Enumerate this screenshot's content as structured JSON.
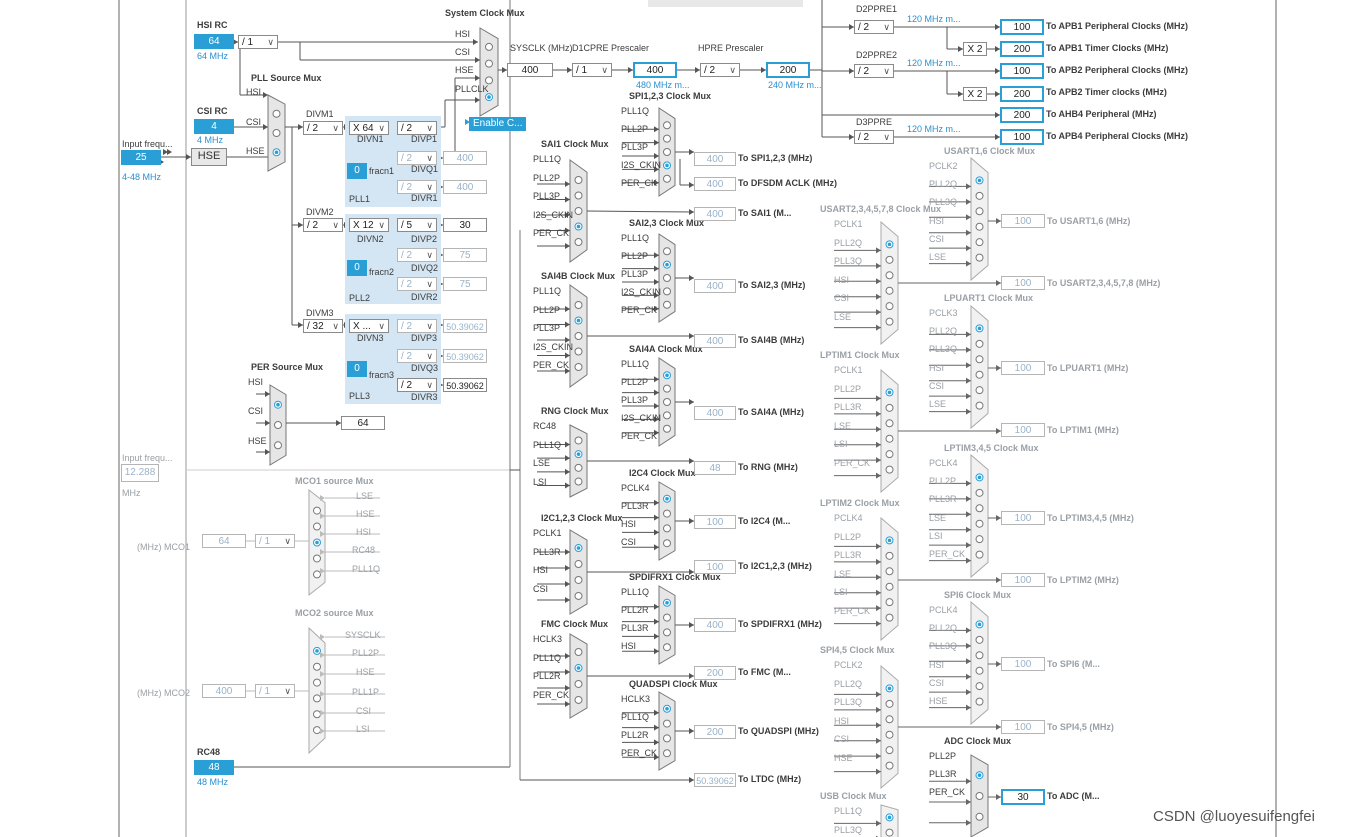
{
  "watermark": "CSDN @luoyesuifengfei",
  "sources": {
    "hsi_rc": {
      "title": "HSI RC",
      "value": "64",
      "freq": "64 MHz"
    },
    "csi_rc": {
      "title": "CSI RC",
      "value": "4",
      "freq": "4 MHz"
    },
    "input_freq": {
      "title": "Input frequ...",
      "value": "25",
      "range": "4-48 MHz",
      "hse_label": "HSE"
    },
    "input_freq2": {
      "title": "Input frequ...",
      "value": "12.288",
      "unit": "MHz"
    },
    "rc48": {
      "title": "RC48",
      "value": "48",
      "freq": "48 MHz"
    }
  },
  "hsi_div": "/ 1",
  "pll_source_mux": {
    "title": "PLL Source Mux",
    "inputs": [
      "HSI",
      "CSI",
      "HSE"
    ]
  },
  "system_clock_mux": {
    "title": "System Clock Mux",
    "inputs": [
      "HSI",
      "CSI",
      "HSE",
      "PLLCLK"
    ],
    "enable_css": "Enable C..."
  },
  "sysclk": {
    "label": "SYSCLK (MHz)",
    "value": "400"
  },
  "d1cpre": {
    "label": "D1CPRE Prescaler",
    "select": "/ 1",
    "value": "400",
    "sub": "480 MHz m..."
  },
  "hpre": {
    "label": "HPRE Prescaler",
    "select": "/ 2",
    "value": "200",
    "sub": "240 MHz m..."
  },
  "bus_outputs": [
    {
      "pre_label": "D2PPRE1",
      "select": "/ 2",
      "max": "120 MHz m...",
      "value": "100",
      "out": "To APB1 Peripheral Clocks (MHz)"
    },
    {
      "mult": "X 2",
      "value": "200",
      "out": "To APB1 Timer Clocks (MHz)"
    },
    {
      "pre_label": "D2PPRE2",
      "select": "/ 2",
      "max": "120 MHz m...",
      "value": "100",
      "out": "To APB2 Peripheral Clocks (MHz)"
    },
    {
      "mult": "X 2",
      "value": "200",
      "out": "To APB2 Timer clocks (MHz)"
    },
    {
      "value": "200",
      "out": "To AHB4 Peripheral (MHz)"
    },
    {
      "pre_label": "D3PPRE",
      "select": "/ 2",
      "max": "120 MHz m...",
      "value": "100",
      "out": "To APB4 Peripheral Clocks (MHz)"
    }
  ],
  "plls": [
    {
      "divm_label": "DIVM1",
      "divm": "/ 2",
      "divn_label": "DIVN1",
      "divn": "X 64",
      "frac": "0",
      "frac_label": "fracn1",
      "name": "PLL1",
      "outs": [
        {
          "label": "DIVP1",
          "sel": "/ 2",
          "value": ""
        },
        {
          "label": "DIVQ1",
          "sel": "/ 2",
          "value": "400"
        },
        {
          "label": "DIVR1",
          "sel": "/ 2",
          "value": "400"
        }
      ]
    },
    {
      "divm_label": "DIVM2",
      "divm": "/ 2",
      "divn_label": "DIVN2",
      "divn": "X 12",
      "frac": "0",
      "frac_label": "fracn2",
      "name": "PLL2",
      "outs": [
        {
          "label": "DIVP2",
          "sel": "/ 5",
          "value": "30"
        },
        {
          "label": "DIVQ2",
          "sel": "/ 2",
          "value": "75"
        },
        {
          "label": "DIVR2",
          "sel": "/ 2",
          "value": "75"
        }
      ]
    },
    {
      "divm_label": "DIVM3",
      "divm": "/ 32",
      "divn_label": "DIVN3",
      "divn": "X ...",
      "frac": "0",
      "frac_label": "fracn3",
      "name": "PLL3",
      "outs": [
        {
          "label": "DIVP3",
          "sel": "/ 2",
          "value": "50.39062"
        },
        {
          "label": "DIVQ3",
          "sel": "/ 2",
          "value": "50.39062"
        },
        {
          "label": "DIVR3",
          "sel": "/ 2",
          "value": "50.39062"
        }
      ]
    }
  ],
  "per_mux": {
    "title": "PER Source Mux",
    "inputs": [
      "HSI",
      "CSI",
      "HSE"
    ],
    "value": "64"
  },
  "mco1": {
    "title": "MCO1 source Mux",
    "inputs": [
      "LSE",
      "HSE",
      "HSI",
      "RC48",
      "PLL1Q"
    ],
    "label": "(MHz) MCO1",
    "value": "64",
    "div": "/ 1"
  },
  "mco2": {
    "title": "MCO2 source Mux",
    "inputs": [
      "SYSCLK",
      "PLL2P",
      "HSE",
      "PLL1P",
      "CSI",
      "LSI"
    ],
    "label": "(MHz) MCO2",
    "value": "400",
    "div": "/ 1"
  },
  "mid_muxes": [
    {
      "title": "SAI1 Clock Mux",
      "inputs": [
        "PLL1Q",
        "PLL2P",
        "PLL3P",
        "I2S_CKIN",
        "PER_CK"
      ]
    },
    {
      "title": "SAI4B Clock Mux",
      "inputs": [
        "PLL1Q",
        "PLL2P",
        "PLL3P",
        "I2S_CKIN",
        "PER_CK"
      ]
    },
    {
      "title": "RNG Clock Mux",
      "inputs": [
        "RC48",
        "PLL1Q",
        "LSE",
        "LSI"
      ]
    },
    {
      "title": "I2C1,2,3 Clock Mux",
      "inputs": [
        "PCLK1",
        "PLL3R",
        "HSI",
        "CSI"
      ]
    },
    {
      "title": "FMC Clock Mux",
      "inputs": [
        "HCLK3",
        "PLL1Q",
        "PLL2R",
        "PER_CK"
      ]
    }
  ],
  "col2_muxes": [
    {
      "title": "SPI1,2,3 Clock Mux",
      "inputs": [
        "PLL1Q",
        "PLL2P",
        "PLL3P",
        "I2S_CKIN",
        "PER_CK"
      ]
    },
    {
      "title": "SAI2,3 Clock Mux",
      "inputs": [
        "PLL1Q",
        "PLL2P",
        "PLL3P",
        "I2S_CKIN",
        "PER_CK"
      ]
    },
    {
      "title": "SAI4A Clock Mux",
      "inputs": [
        "PLL1Q",
        "PLL2P",
        "PLL3P",
        "I2S_CKIN",
        "PER_CK"
      ]
    },
    {
      "title": "I2C4 Clock Mux",
      "inputs": [
        "PCLK4",
        "PLL3R",
        "HSI",
        "CSI"
      ]
    },
    {
      "title": "SPDIFRX1 Clock Mux",
      "inputs": [
        "PLL1Q",
        "PLL2R",
        "PLL3R",
        "HSI"
      ]
    },
    {
      "title": "QUADSPI Clock Mux",
      "inputs": [
        "HCLK3",
        "PLL1Q",
        "PLL2R",
        "PER_CK"
      ]
    }
  ],
  "col2_outputs": [
    {
      "value": "400",
      "out": "To SPI1,2,3 (MHz)"
    },
    {
      "value": "400",
      "out": "To DFSDM ACLK (MHz)"
    },
    {
      "value": "400",
      "out": "To SAI1 (M..."
    },
    {
      "value": "400",
      "out": "To SAI2,3 (MHz)"
    },
    {
      "value": "400",
      "out": "To SAI4B (MHz)"
    },
    {
      "value": "400",
      "out": "To SAI4A (MHz)"
    },
    {
      "value": "48",
      "out": "To RNG (MHz)"
    },
    {
      "value": "100",
      "out": "To I2C4 (M..."
    },
    {
      "value": "100",
      "out": "To I2C1,2,3 (MHz)"
    },
    {
      "value": "400",
      "out": "To SPDIFRX1 (MHz)"
    },
    {
      "value": "200",
      "out": "To FMC (M..."
    },
    {
      "value": "200",
      "out": "To QUADSPI (MHz)"
    },
    {
      "value": "50.39062",
      "out": "To LTDC (MHz)"
    }
  ],
  "col3_muxes": [
    {
      "title": "USART2,3,4,5,7,8 Clock Mux",
      "inputs": [
        "PCLK1",
        "PLL2Q",
        "PLL3Q",
        "HSI",
        "CSI",
        "LSE"
      ]
    },
    {
      "title": "LPTIM1 Clock Mux",
      "inputs": [
        "PCLK1",
        "PLL2P",
        "PLL3R",
        "LSE",
        "LSI",
        "PER_CK"
      ]
    },
    {
      "title": "LPTIM2 Clock Mux",
      "inputs": [
        "PCLK4",
        "PLL2P",
        "PLL3R",
        "LSE",
        "LSI",
        "PER_CK"
      ]
    },
    {
      "title": "SPI4,5 Clock Mux",
      "inputs": [
        "PCLK2",
        "PLL2Q",
        "PLL3Q",
        "HSI",
        "CSI",
        "HSE"
      ]
    },
    {
      "title": "USB Clock Mux",
      "inputs": [
        "PLL1Q",
        "PLL3Q"
      ]
    }
  ],
  "col4_muxes": [
    {
      "title": "USART1,6 Clock Mux",
      "inputs": [
        "PCLK2",
        "PLL2Q",
        "PLL3Q",
        "HSI",
        "CSI",
        "LSE"
      ]
    },
    {
      "title": "LPUART1 Clock Mux",
      "inputs": [
        "PCLK3",
        "PLL2Q",
        "PLL3Q",
        "HSI",
        "CSI",
        "LSE"
      ]
    },
    {
      "title": "LPTIM3,4,5 Clock Mux",
      "inputs": [
        "PCLK4",
        "PLL2P",
        "PLL3R",
        "LSE",
        "LSI",
        "PER_CK"
      ]
    },
    {
      "title": "SPI6 Clock Mux",
      "inputs": [
        "PCLK4",
        "PLL2Q",
        "PLL3Q",
        "HSI",
        "CSI",
        "HSE"
      ]
    },
    {
      "title": "ADC Clock Mux",
      "inputs": [
        "PLL2P",
        "PLL3R",
        "PER_CK"
      ]
    }
  ],
  "col4_outputs": [
    {
      "value": "100",
      "out": "To USART1,6 (MHz)"
    },
    {
      "value": "100",
      "out": "To USART2,3,4,5,7,8 (MHz)"
    },
    {
      "value": "100",
      "out": "To LPUART1 (MHz)"
    },
    {
      "value": "100",
      "out": "To LPTIM1 (MHz)"
    },
    {
      "value": "100",
      "out": "To LPTIM3,4,5 (MHz)"
    },
    {
      "value": "100",
      "out": "To LPTIM2 (MHz)"
    },
    {
      "value": "100",
      "out": "To SPI6 (M..."
    },
    {
      "value": "100",
      "out": "To SPI4,5 (MHz)"
    },
    {
      "value": "30",
      "out": "To ADC (M..."
    }
  ]
}
